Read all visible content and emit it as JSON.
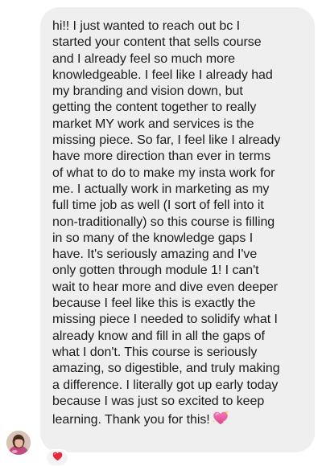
{
  "message": {
    "lines": [
      "hi!! I just wanted to reach out bc I",
      "started your content that sells course",
      "and I already feel so much more",
      "knowledgeable. I feel like I already had",
      "my branding and vision down, but",
      "getting the content together to really",
      "market MY work and services is the",
      "missing piece. So far, I feel like I already",
      "have more direction than ever in terms",
      "of what to do to make my insta work for",
      "me. I actually work in marketing as my",
      "full time job as well (I sort of fell into it",
      "non-traditionally) so this course is filling",
      "in so many of the knowledge gaps I",
      "have. It's seriously amazing and I've",
      "only gotten through module 1! I can't",
      "wait to hear more and dive even deeper",
      "because I feel like this is exactly the",
      "missing piece I needed to solidify what I",
      "already know and fill in all the gaps of",
      "what I don't. This course is seriously",
      "amazing, so digestible, and truly making",
      "a difference. I literally got up early today",
      "because I was just so excited to keep",
      "learning. Thank you for this!"
    ],
    "trailing_emoji": "sparkling-heart-icon"
  },
  "reaction": {
    "icon": "red-heart-icon"
  },
  "colors": {
    "bubble": "#efefef",
    "text": "#1c1c1c",
    "heart_red": "#e8283e",
    "sparkle_pink": "#e65c9f"
  }
}
